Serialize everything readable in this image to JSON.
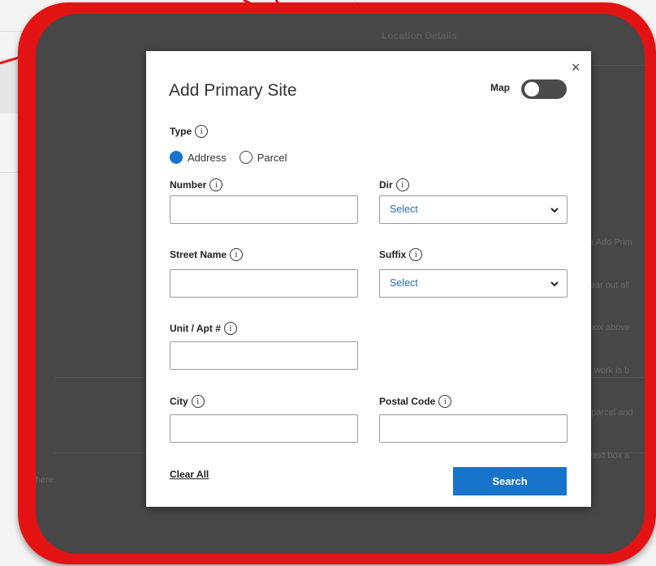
{
  "background": {
    "section_heading": "Location Details",
    "side_text_lines": [
      "ue Add Prim",
      "clear out all",
      "t box above",
      "re work is b",
      "e parcel and",
      "s text box a"
    ],
    "footer_text": "here."
  },
  "modal": {
    "title": "Add Primary Site",
    "close_glyph": "×",
    "map_toggle": {
      "label": "Map",
      "on": false
    },
    "type": {
      "label": "Type",
      "options": [
        {
          "label": "Address",
          "selected": true
        },
        {
          "label": "Parcel",
          "selected": false
        }
      ]
    },
    "fields": {
      "number": {
        "label": "Number",
        "value": ""
      },
      "dir": {
        "label": "Dir",
        "value": "Select"
      },
      "street_name": {
        "label": "Street Name",
        "value": ""
      },
      "suffix": {
        "label": "Suffix",
        "value": "Select"
      },
      "unit_apt": {
        "label": "Unit / Apt #",
        "value": ""
      },
      "city": {
        "label": "City",
        "value": ""
      },
      "postal_code": {
        "label": "Postal Code",
        "value": ""
      }
    },
    "info_glyph": "i",
    "clear_all": "Clear All",
    "search": "Search"
  },
  "colors": {
    "highlight_frame": "#e31313",
    "overlay": "#474747",
    "primary": "#1873cc",
    "select_text": "#2a6bb8"
  }
}
